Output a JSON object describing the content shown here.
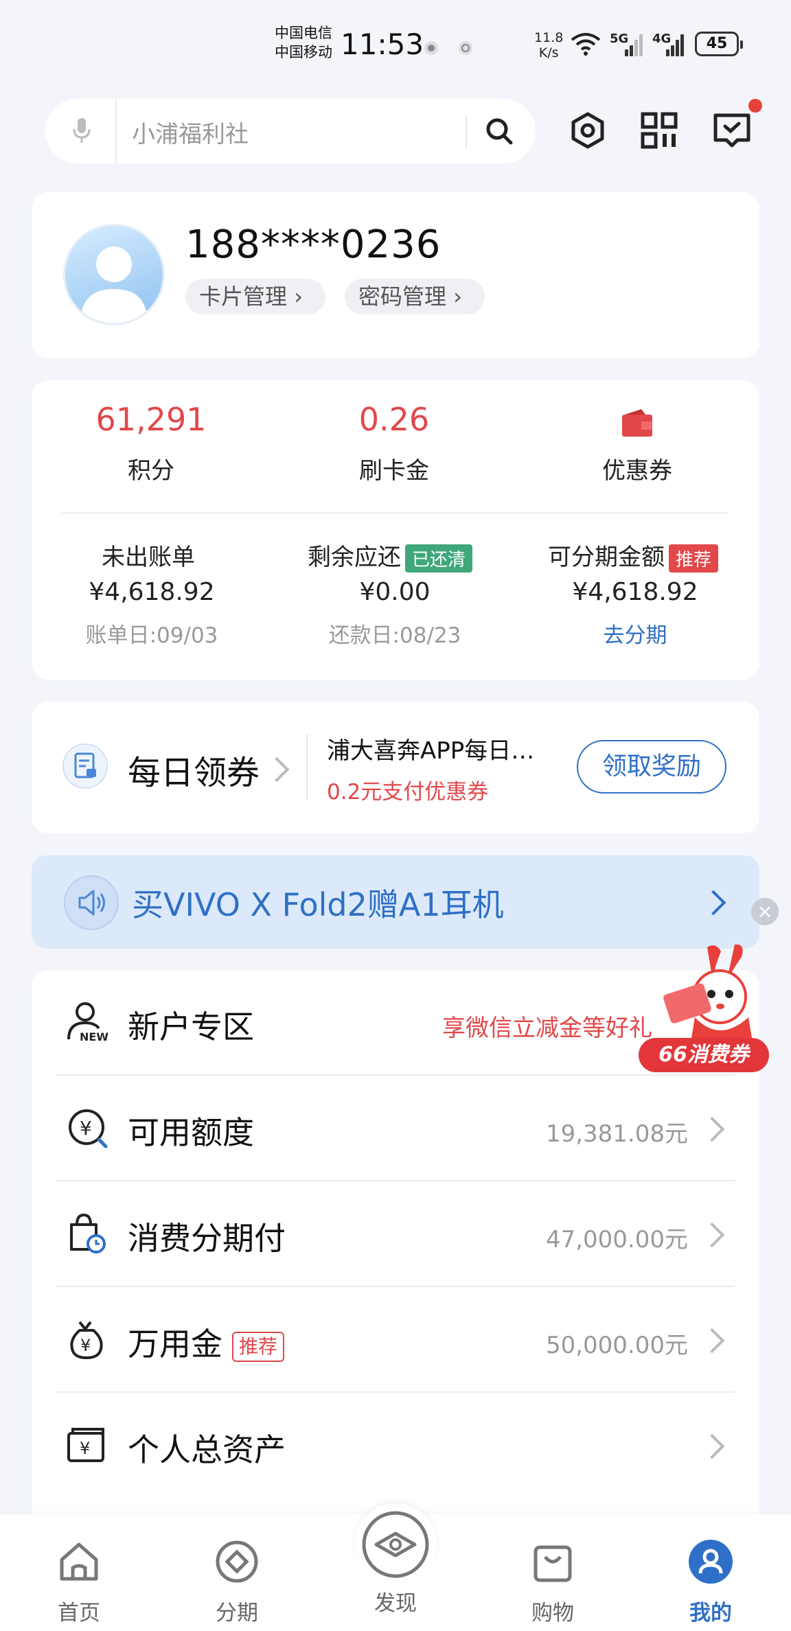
{
  "status_bar": {
    "carrier_1": "中国电信",
    "carrier_2": "中国移动",
    "time": "11:53",
    "speed_value": "11.8",
    "speed_unit": "K/s",
    "net_1": "5G",
    "net_2": "4G",
    "battery": "45"
  },
  "search": {
    "placeholder": "小浦福利社"
  },
  "profile": {
    "phone": "188****0236",
    "card_manage": "卡片管理",
    "password_manage": "密码管理"
  },
  "stats": [
    {
      "value": "61,291",
      "label": "积分"
    },
    {
      "value": "0.26",
      "label": "刷卡金"
    },
    {
      "value": "",
      "label": "优惠券"
    }
  ],
  "bills": {
    "unbilled": {
      "title": "未出账单",
      "amount": "¥4,618.92",
      "sub": "账单日:09/03"
    },
    "remaining": {
      "title": "剩余应还",
      "tag": "已还清",
      "amount": "¥0.00",
      "sub": "还款日:08/23"
    },
    "installable": {
      "title": "可分期金额",
      "tag": "推荐",
      "amount": "¥4,618.92",
      "sub": "去分期"
    }
  },
  "coupon_card": {
    "title": "每日领券",
    "promo_title": "浦大喜奔APP每日…",
    "promo_sub": "0.2元支付优惠券",
    "button": "领取奖励"
  },
  "banner": {
    "text": "买VIVO X Fold2赠A1耳机"
  },
  "floating_promo": {
    "label": "66消费券"
  },
  "list": [
    {
      "label": "新户专区",
      "value": "享微信立减金等好礼"
    },
    {
      "label": "可用额度",
      "value": "19,381.08元"
    },
    {
      "label": "消费分期付",
      "value": "47,000.00元"
    },
    {
      "label": "万用金",
      "tag": "推荐",
      "value": "50,000.00元"
    },
    {
      "label": "个人总资产",
      "value": ""
    }
  ],
  "tabs": [
    {
      "label": "首页"
    },
    {
      "label": "分期"
    },
    {
      "label": "发现"
    },
    {
      "label": "购物"
    },
    {
      "label": "我的"
    }
  ],
  "colors": {
    "accent_red": "#e2474a",
    "accent_blue": "#2f6fc7",
    "paid_green": "#3fa77a",
    "banner_bg": "#dce9fa"
  }
}
